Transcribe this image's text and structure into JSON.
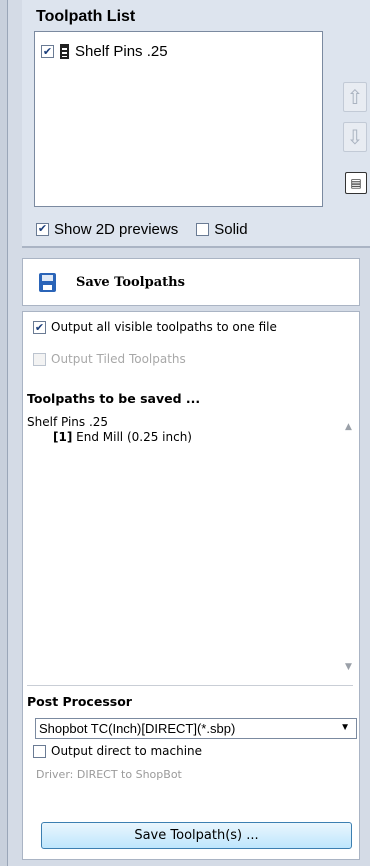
{
  "toolpath_list": {
    "title": "Toolpath List",
    "items": [
      {
        "label": "Shelf Pins .25",
        "checked": true,
        "icon": "toolpath-stack-icon"
      }
    ],
    "move_up_icon": "arrow-up-icon",
    "move_down_icon": "arrow-down-icon",
    "properties_icon": "properties-icon"
  },
  "previews": {
    "show_2d_label": "Show 2D previews",
    "show_2d_checked": true,
    "solid_label": "Solid",
    "solid_checked": false
  },
  "save_panel": {
    "title": "Save Toolpaths",
    "icon": "floppy-disk-icon",
    "output_visible_label": "Output all visible toolpaths to one file",
    "output_visible_checked": true,
    "output_tiled_label": "Output Tiled Toolpaths",
    "output_tiled_checked": false,
    "toolpaths_title": "Toolpaths to be saved ...",
    "toolpaths": [
      {
        "name": "Shelf Pins .25",
        "tool_index": "[1]",
        "tool": "End Mill (0.25 inch)"
      }
    ],
    "post_processor_title": "Post Processor",
    "post_processor_value": "Shopbot TC(Inch)[DIRECT](*.sbp)",
    "output_direct_label": "Output direct to machine",
    "output_direct_checked": false,
    "driver_text": "Driver: DIRECT to ShopBot",
    "save_button_label": "Save Toolpath(s) ..."
  },
  "colors": {
    "panel_bg": "#dde4ee",
    "button_border": "#3c7fb1",
    "disabled_text": "#a8a8a8"
  }
}
